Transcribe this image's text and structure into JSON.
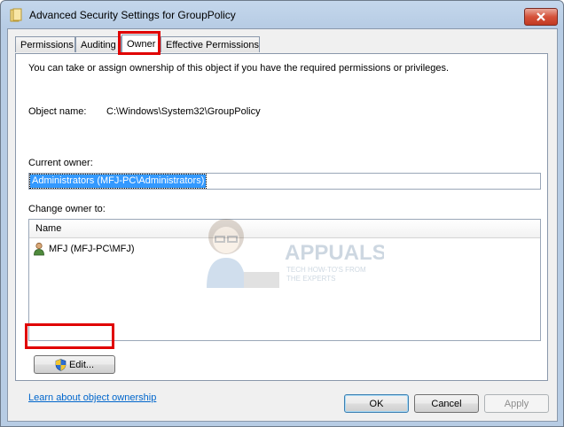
{
  "window": {
    "title": "Advanced Security Settings for GroupPolicy"
  },
  "tabs": [
    {
      "label": "Permissions"
    },
    {
      "label": "Auditing"
    },
    {
      "label": "Owner",
      "active": true
    },
    {
      "label": "Effective Permissions"
    }
  ],
  "owner_tab": {
    "intro": "You can take or assign ownership of this object if you have the required permissions or privileges.",
    "object_name_label": "Object name:",
    "object_name_value": "C:\\Windows\\System32\\GroupPolicy",
    "current_owner_label": "Current owner:",
    "current_owner_value": "Administrators (MFJ-PC\\Administrators)",
    "change_owner_label": "Change owner to:",
    "list_header_name": "Name",
    "list_items": [
      {
        "name": "MFJ (MFJ-PC\\MFJ)",
        "icon": "user-icon"
      }
    ],
    "edit_button": "Edit...",
    "learn_link": "Learn about object ownership"
  },
  "watermark": {
    "brand": "APPUALS",
    "tagline_line1": "TECH HOW-TO'S FROM",
    "tagline_line2": "THE EXPERTS"
  },
  "footer": {
    "ok": "OK",
    "cancel": "Cancel",
    "apply": "Apply"
  },
  "colors": {
    "highlight_box": "#e00000",
    "selection": "#3399ff",
    "link": "#0066cc"
  }
}
